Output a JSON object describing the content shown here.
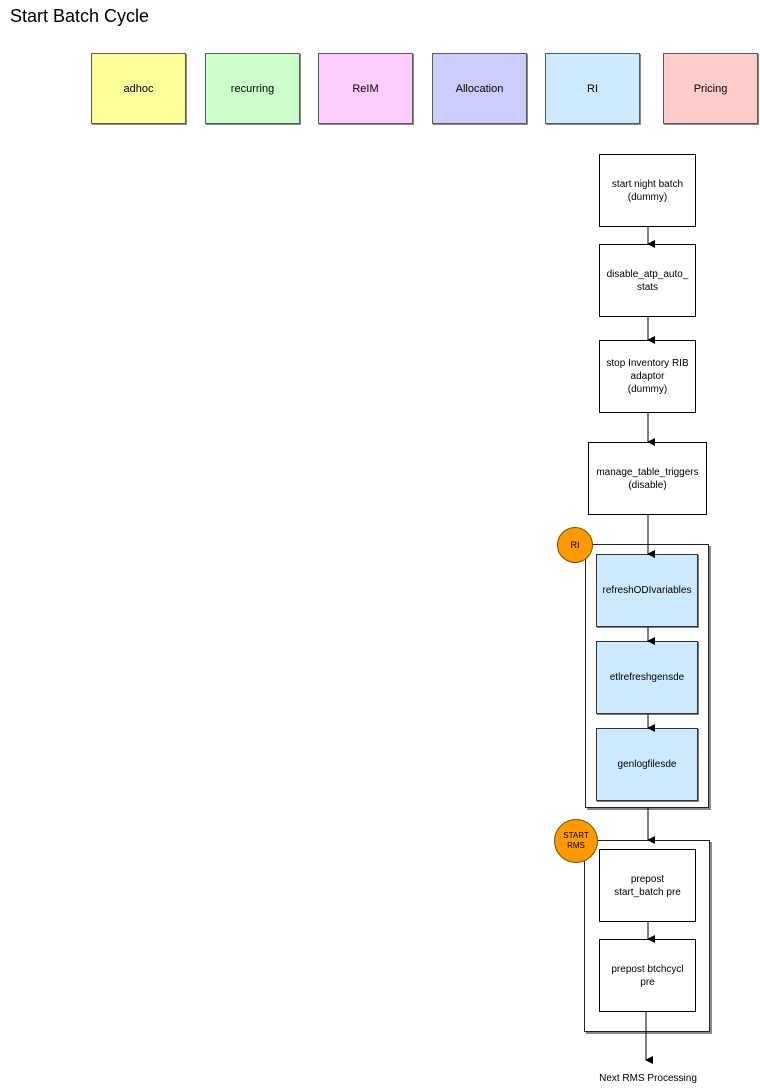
{
  "title": "Start Batch Cycle",
  "legend": [
    {
      "label": "adhoc",
      "color": "#ffff99"
    },
    {
      "label": "recurring",
      "color": "#ccffcc"
    },
    {
      "label": "ReIM",
      "color": "#ffccff"
    },
    {
      "label": "Allocation",
      "color": "#ccccff"
    },
    {
      "label": "RI",
      "color": "#cce9ff"
    },
    {
      "label": "Pricing",
      "color": "#ffcccc"
    }
  ],
  "steps": {
    "start_night_batch": "start night batch\n(dummy)",
    "disable_atp_auto_stats": "disable_atp_auto_\nstats",
    "stop_inventory_rib_adaptor": "stop Inventory RIB\nadaptor\n(dummy)",
    "manage_table_triggers": "manage_table_triggers\n(disable)"
  },
  "groups": {
    "ri": {
      "badge": "RI",
      "color": "#ff9900",
      "steps": [
        "refreshODIvariables",
        "etlrefreshgensde",
        "genlogfilesde"
      ]
    },
    "start_rms": {
      "badge": "START\nRMS",
      "color": "#ff9900",
      "steps": [
        "prepost\nstart_batch pre",
        "prepost btchcycl\npre"
      ]
    }
  },
  "next_label": "Next RMS Processing"
}
